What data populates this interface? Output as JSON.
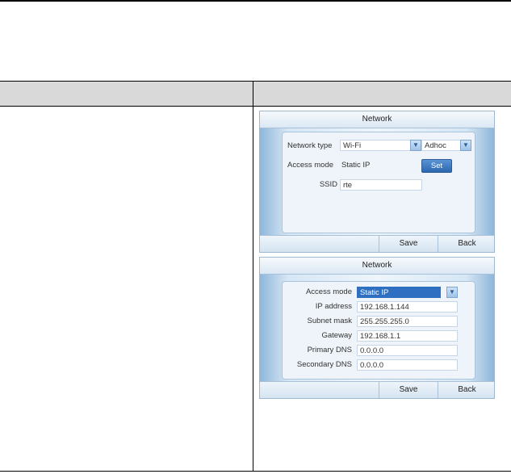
{
  "panel1": {
    "title": "Network",
    "network_type_label": "Network type",
    "network_type_value": "Wi-Fi",
    "network_mode_value": "Adhoc",
    "access_mode_label": "Access mode",
    "access_mode_value": "Static IP",
    "set_label": "Set",
    "ssid_label": "SSID",
    "ssid_value": "rte",
    "save_label": "Save",
    "back_label": "Back"
  },
  "panel2": {
    "title": "Network",
    "access_mode_label": "Access mode",
    "access_mode_value": "Static IP",
    "ip_label": "IP address",
    "ip_value": "192.168.1.144",
    "subnet_label": "Subnet mask",
    "subnet_value": "255.255.255.0",
    "gateway_label": "Gateway",
    "gateway_value": "192.168.1.1",
    "dns1_label": "Primary DNS",
    "dns1_value": "0.0.0.0",
    "dns2_label": "Secondary DNS",
    "dns2_value": "0.0.0.0",
    "save_label": "Save",
    "back_label": "Back"
  },
  "icons": {
    "dropdown": "chevron-down-icon"
  }
}
